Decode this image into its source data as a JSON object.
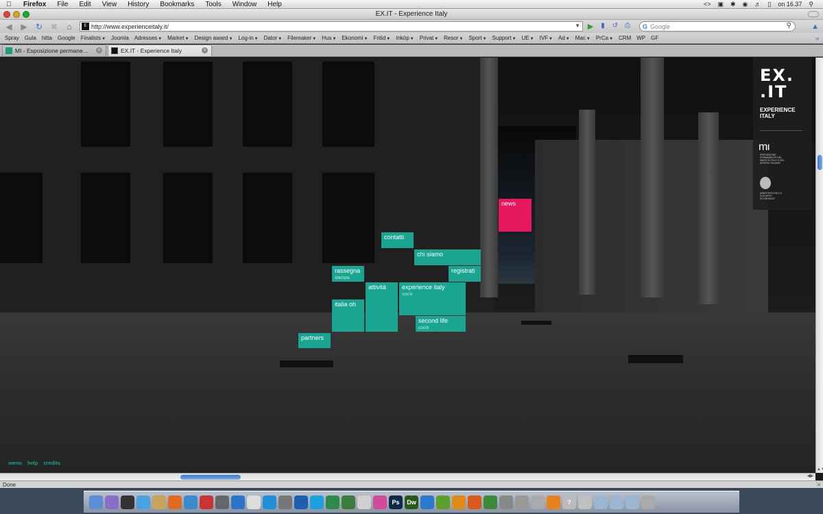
{
  "menubar": {
    "app": "Firefox",
    "items": [
      "File",
      "Edit",
      "View",
      "History",
      "Bookmarks",
      "Tools",
      "Window",
      "Help"
    ],
    "clock": "on 16.37"
  },
  "window": {
    "title": "EX.IT - Experience Italy"
  },
  "navbar": {
    "url": "http://www.experienceitaly.it/",
    "search_placeholder": "Google"
  },
  "bookmarks": [
    {
      "label": "Spray",
      "menu": false
    },
    {
      "label": "Gula",
      "menu": false
    },
    {
      "label": "hitta",
      "menu": false
    },
    {
      "label": "Google",
      "menu": false
    },
    {
      "label": "Finalists",
      "menu": true
    },
    {
      "label": "Joomla",
      "menu": false
    },
    {
      "label": "Adresses",
      "menu": true
    },
    {
      "label": "Market",
      "menu": true
    },
    {
      "label": "Design award",
      "menu": true
    },
    {
      "label": "Log-in",
      "menu": true
    },
    {
      "label": "Dator",
      "menu": true
    },
    {
      "label": "Filemaker",
      "menu": true
    },
    {
      "label": "Hus",
      "menu": true
    },
    {
      "label": "Ekonomi",
      "menu": true
    },
    {
      "label": "Fritid",
      "menu": true
    },
    {
      "label": "Inköp",
      "menu": true
    },
    {
      "label": "Privat",
      "menu": true
    },
    {
      "label": "Resor",
      "menu": true
    },
    {
      "label": "Sport",
      "menu": true
    },
    {
      "label": "Support",
      "menu": true
    },
    {
      "label": "UE",
      "menu": true
    },
    {
      "label": "IVF",
      "menu": true
    },
    {
      "label": "Ad",
      "menu": true
    },
    {
      "label": "Mac",
      "menu": true
    },
    {
      "label": "PrCa",
      "menu": true
    },
    {
      "label": "CRM",
      "menu": false
    },
    {
      "label": "WP",
      "menu": false
    },
    {
      "label": "GF",
      "menu": false
    }
  ],
  "tabs": [
    {
      "label": "MI - Esposizione permanente ...",
      "active": false
    },
    {
      "label": "EX.IT - Experience Italy",
      "active": true
    }
  ],
  "site": {
    "tiles": {
      "news": {
        "title": "news",
        "sub": ""
      },
      "contatti": {
        "title": "contatti",
        "sub": ""
      },
      "chi_siamo": {
        "title": "chi siamo",
        "sub": ""
      },
      "registrati": {
        "title": "registrati",
        "sub": ""
      },
      "rassegna": {
        "title": "rassegna",
        "sub": "stampa"
      },
      "attivita": {
        "title": "attività",
        "sub": ""
      },
      "experience_italy": {
        "title": "experience italy",
        "sub": "cos'è"
      },
      "italia_oh": {
        "title": "italia oh",
        "sub": ""
      },
      "second_life": {
        "title": "second life",
        "sub": "cos'è"
      },
      "partners": {
        "title": "partners",
        "sub": ""
      }
    },
    "logo": {
      "mark_line1": "EX.",
      "mark_line2": ".IT",
      "text_line1": "EXPERIENCE",
      "text_line2": "ITALY",
      "mi_mark": "mı",
      "mi_text": "ESPOSIZIONE PERMANENTE DEL MADE IN ITALY E DEL DESIGN ITALIANO",
      "ministry_text": "MINISTERO DELLO SVILUPPO ECONOMICO"
    },
    "footer": [
      "menu",
      "help",
      "credits"
    ],
    "accent_color": "#1aa593",
    "news_color": "#e8185e"
  },
  "status": {
    "text": "Done"
  }
}
